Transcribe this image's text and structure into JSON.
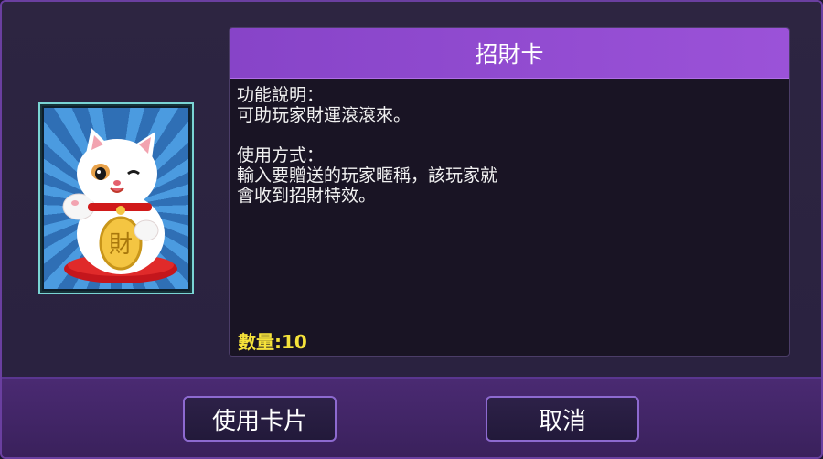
{
  "card": {
    "title": "招財卡",
    "image_icon": "maneki-neko-icon",
    "description_lines": [
      "功能說明：",
      "可助玩家財運滾滾來。",
      "",
      "使用方式：",
      "輸入要贈送的玩家暱稱，該玩家就",
      "會收到招財特效。"
    ],
    "quantity_label": "數量:10",
    "coin_char": "財"
  },
  "buttons": {
    "use_label": "使用卡片",
    "cancel_label": "取消"
  },
  "colors": {
    "header": "#8f48d0",
    "quantity": "#f5e23a",
    "button_border": "#8d6ad0"
  }
}
